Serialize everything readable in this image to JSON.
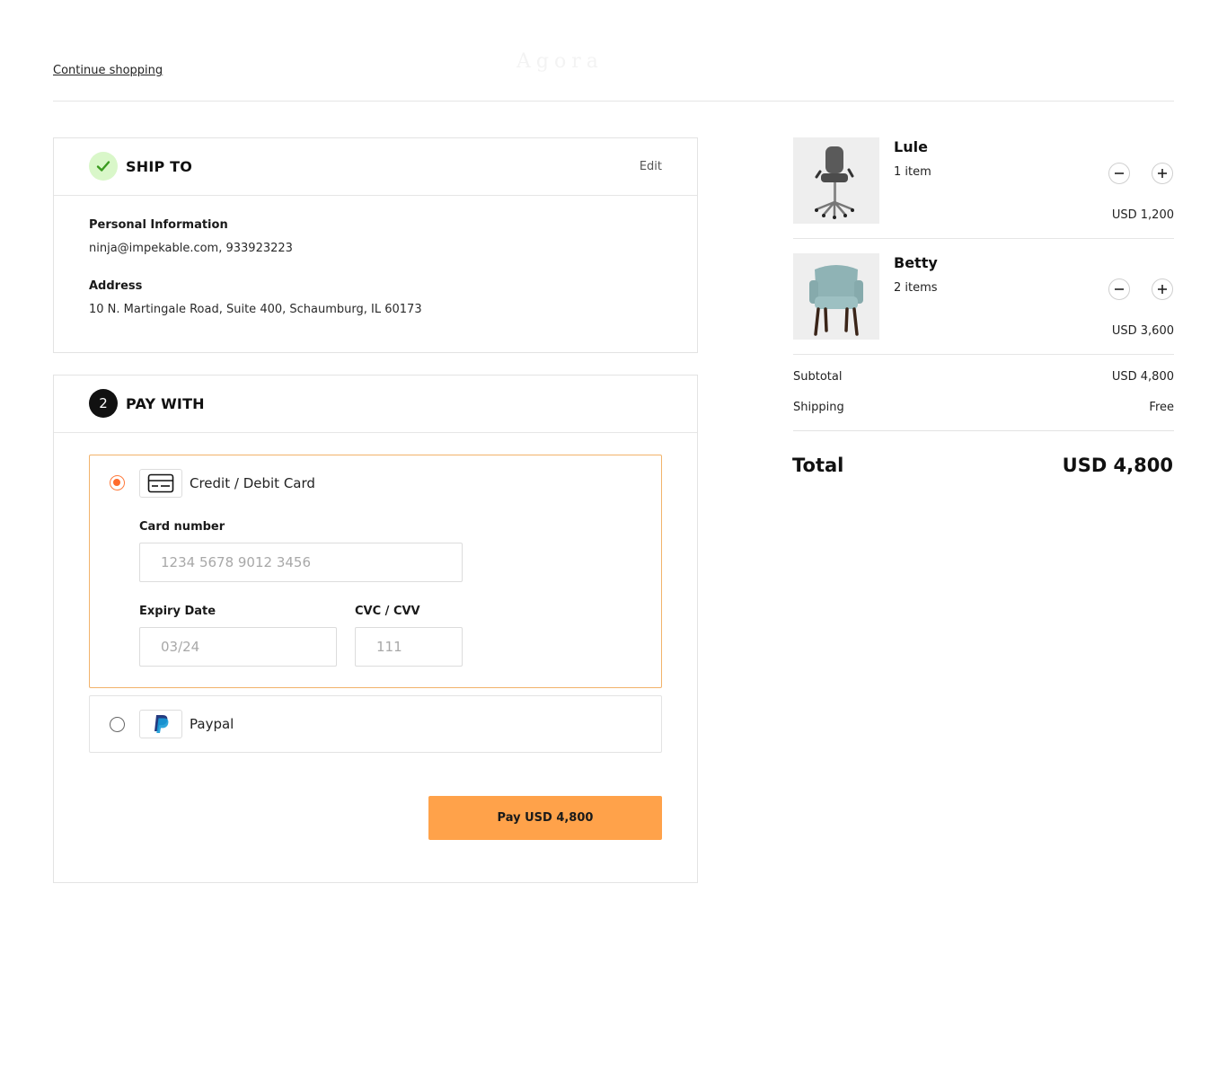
{
  "header": {
    "continue_label": "Continue shopping",
    "logo_text": "Agora"
  },
  "ship": {
    "title": "SHIP TO",
    "edit_label": "Edit",
    "personal_label": "Personal Information",
    "personal_value": "ninja@impekable.com, 933923223",
    "address_label": "Address",
    "address_value": "10 N. Martingale Road, Suite 400, Schaumburg, IL 60173",
    "status_icon": "check-icon"
  },
  "pay": {
    "step_number": "2",
    "title": "PAY WITH",
    "card_label": "Credit / Debit Card",
    "card_icon": "credit-card-icon",
    "card_number_label": "Card number",
    "card_number_placeholder": "1234 5678 9012 3456",
    "expiry_label": "Expiry Date",
    "expiry_placeholder": "03/24",
    "cvc_label": "CVC / CVV",
    "cvc_placeholder": "111",
    "paypal_label": "Paypal",
    "paypal_icon": "paypal-icon",
    "selected_method": "card",
    "button_label": "Pay USD 4,800"
  },
  "cart": {
    "items": [
      {
        "name": "Lule",
        "qty": "1 item",
        "price": "USD 1,200",
        "image": "office-chair-image"
      },
      {
        "name": "Betty",
        "qty": "2 items",
        "price": "USD 3,600",
        "image": "armchair-image"
      }
    ],
    "subtotal_label": "Subtotal",
    "subtotal_value": "USD 4,800",
    "shipping_label": "Shipping",
    "shipping_value": "Free",
    "total_label": "Total",
    "total_value": "USD 4,800"
  },
  "colors": {
    "accent": "#ffa24a",
    "radio_selected": "#ff6a2b",
    "success_bg": "#d9f7c9",
    "success_check": "#3a9b1f",
    "selected_border": "#f2b36b"
  }
}
